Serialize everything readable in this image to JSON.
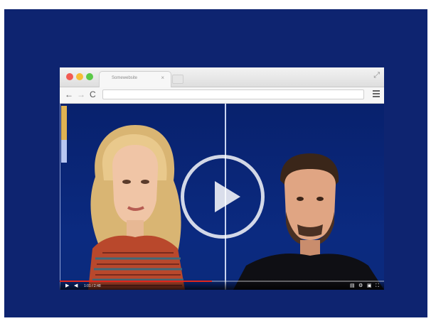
{
  "browser": {
    "tab_title": "Somewebsite",
    "tab_close_icon": "close-icon",
    "expand_icon": "expand-icon",
    "address_value": "",
    "nav": {
      "back_glyph": "←",
      "forward_glyph": "→",
      "reload_glyph": "C",
      "expand_glyph": "⤢",
      "close_glyph": "×"
    }
  },
  "video": {
    "progress_fraction": 0.47,
    "time_label": "1:01 / 2:48",
    "controls": {
      "play_glyph": "▶",
      "volume_glyph": "◀",
      "cc_glyph": "▤",
      "settings_glyph": "⚙",
      "miniplayer_glyph": "▣",
      "fullscreen_glyph": "⛶"
    }
  },
  "colors": {
    "slide_bg": "#0e2470",
    "progress": "#e2261c",
    "accent_scroll": "#e0b352"
  }
}
